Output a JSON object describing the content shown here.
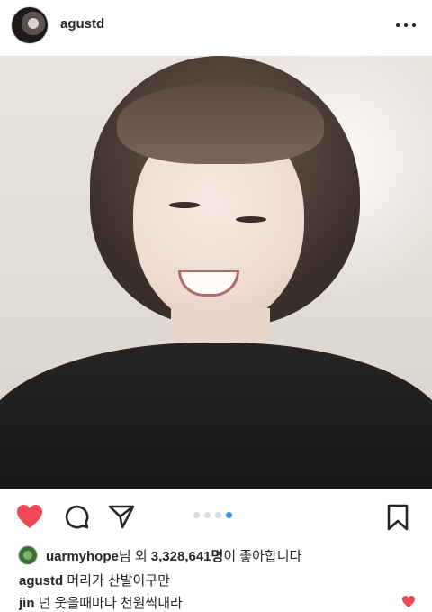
{
  "post": {
    "username": "agustd"
  },
  "carousel": {
    "count": 4,
    "active_index": 3,
    "active_color": "#3897f0"
  },
  "actions": {
    "liked": true,
    "like_color": "#ed4956"
  },
  "likes": {
    "liker_username": "uarmyhope",
    "text_middle": "님 외 ",
    "count": "3,328,641명",
    "text_end": "이 좋아합니다"
  },
  "comments": [
    {
      "username": "agustd",
      "text": "머리가 산발이구만"
    },
    {
      "username": "jin",
      "text": "넌 웃을때마다 천원씩내라",
      "liked": true
    }
  ]
}
